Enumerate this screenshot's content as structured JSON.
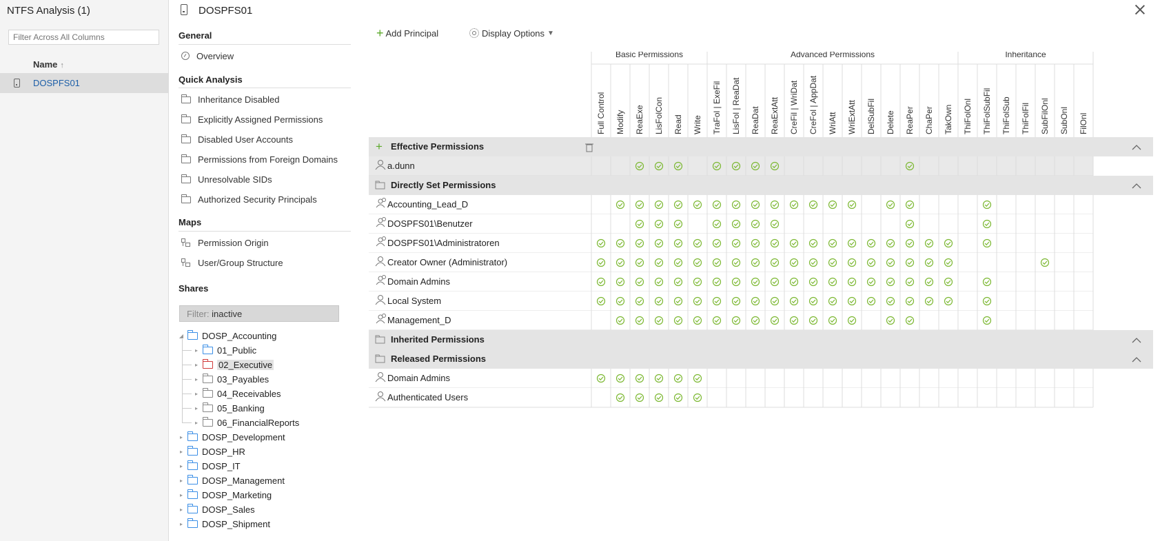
{
  "window_title": "NTFS Analysis (1)",
  "left_panel": {
    "filter_placeholder": "Filter Across All Columns",
    "column_header": "Name",
    "sort_arrow": "↑",
    "selected_item": "DOSPFS01"
  },
  "middle_panel": {
    "header_title": "DOSPFS01",
    "general": {
      "title": "General",
      "items": [
        "Overview"
      ]
    },
    "quick_analysis": {
      "title": "Quick Analysis",
      "items": [
        "Inheritance Disabled",
        "Explicitly Assigned Permissions",
        "Disabled User Accounts",
        "Permissions from Foreign Domains",
        "Unresolvable SIDs",
        "Authorized Security Principals"
      ]
    },
    "maps": {
      "title": "Maps",
      "items": [
        "Permission Origin",
        "User/Group Structure"
      ]
    },
    "shares": {
      "title": "Shares",
      "filter_key": "Filter:",
      "filter_value": "inactive",
      "tree": [
        {
          "label": "DOSP_Accounting",
          "level": 0,
          "expanded": true,
          "color": "blue"
        },
        {
          "label": "01_Public",
          "level": 1,
          "color": "blue"
        },
        {
          "label": "02_Executive",
          "level": 1,
          "color": "red",
          "selected": true
        },
        {
          "label": "03_Payables",
          "level": 1,
          "color": "grey"
        },
        {
          "label": "04_Receivables",
          "level": 1,
          "color": "grey"
        },
        {
          "label": "05_Banking",
          "level": 1,
          "color": "grey"
        },
        {
          "label": "06_FinancialReports",
          "level": 1,
          "color": "grey"
        },
        {
          "label": "DOSP_Development",
          "level": 0,
          "color": "blue"
        },
        {
          "label": "DOSP_HR",
          "level": 0,
          "color": "blue"
        },
        {
          "label": "DOSP_IT",
          "level": 0,
          "color": "blue"
        },
        {
          "label": "DOSP_Management",
          "level": 0,
          "color": "blue"
        },
        {
          "label": "DOSP_Marketing",
          "level": 0,
          "color": "blue"
        },
        {
          "label": "DOSP_Sales",
          "level": 0,
          "color": "blue"
        },
        {
          "label": "DOSP_Shipment",
          "level": 0,
          "color": "blue"
        }
      ]
    }
  },
  "toolbar": {
    "add_principal": "Add Principal",
    "display_options": "Display Options"
  },
  "matrix": {
    "groups": [
      {
        "label": "Basic Permissions",
        "span": 6
      },
      {
        "label": "Advanced Permissions",
        "span": 13
      },
      {
        "label": "Inheritance",
        "span": 7
      }
    ],
    "columns": [
      "Full Control",
      "Modify",
      "ReaExe",
      "LisFolCon",
      "Read",
      "Write",
      "TraFol | ExeFil",
      "LisFol | ReaDat",
      "ReaDat",
      "ReaExtAtt",
      "CreFil | WriDat",
      "CreFol | AppDat",
      "WriAtt",
      "WriExtAtt",
      "DelSubFil",
      "Delete",
      "ReaPer",
      "ChaPer",
      "TakOwn",
      "ThiFolOnl",
      "ThiFolSubFil",
      "ThiFolSub",
      "ThiFolFil",
      "SubFilOnl",
      "SubOnl",
      "FilOnl"
    ],
    "sections": [
      {
        "title": "Effective Permissions",
        "icon": "plus",
        "rows": [
          {
            "name": "a.dunn",
            "kind": "user",
            "checks": [
              2,
              3,
              4,
              6,
              7,
              8,
              9,
              16
            ]
          }
        ]
      },
      {
        "title": "Directly Set Permissions",
        "icon": "folder",
        "rows": [
          {
            "name": "Accounting_Lead_D",
            "kind": "group",
            "checks": [
              1,
              2,
              3,
              4,
              5,
              6,
              7,
              8,
              9,
              10,
              11,
              12,
              13,
              15,
              16,
              20
            ]
          },
          {
            "name": "DOSPFS01\\Benutzer",
            "kind": "group",
            "checks": [
              2,
              3,
              4,
              6,
              7,
              8,
              9,
              16,
              20
            ]
          },
          {
            "name": "DOSPFS01\\Administratoren",
            "kind": "group",
            "checks": [
              0,
              1,
              2,
              3,
              4,
              5,
              6,
              7,
              8,
              9,
              10,
              11,
              12,
              13,
              14,
              15,
              16,
              17,
              18,
              20
            ]
          },
          {
            "name": "Creator Owner (Administrator)",
            "kind": "user",
            "checks": [
              0,
              1,
              2,
              3,
              4,
              5,
              6,
              7,
              8,
              9,
              10,
              11,
              12,
              13,
              14,
              15,
              16,
              17,
              18,
              23
            ]
          },
          {
            "name": "Domain Admins",
            "kind": "group",
            "checks": [
              0,
              1,
              2,
              3,
              4,
              5,
              6,
              7,
              8,
              9,
              10,
              11,
              12,
              13,
              14,
              15,
              16,
              17,
              18,
              20
            ]
          },
          {
            "name": "Local System",
            "kind": "user",
            "checks": [
              0,
              1,
              2,
              3,
              4,
              5,
              6,
              7,
              8,
              9,
              10,
              11,
              12,
              13,
              14,
              15,
              16,
              17,
              18,
              20
            ]
          },
          {
            "name": "Management_D",
            "kind": "group",
            "checks": [
              1,
              2,
              3,
              4,
              5,
              6,
              7,
              8,
              9,
              10,
              11,
              12,
              13,
              15,
              16,
              20
            ]
          }
        ]
      },
      {
        "title": "Inherited Permissions",
        "icon": "folder",
        "rows": []
      },
      {
        "title": "Released Permissions",
        "icon": "folder",
        "rows": [
          {
            "name": "Domain Admins",
            "kind": "user",
            "checks": [
              0,
              1,
              2,
              3,
              4,
              5
            ]
          },
          {
            "name": "Authenticated Users",
            "kind": "user",
            "checks": [
              1,
              2,
              3,
              4,
              5
            ]
          }
        ]
      }
    ],
    "colors": {
      "check": "#7cb832",
      "section_bg": "#e4e4e4",
      "highlight_row": "#e9e9e9",
      "grid": "#dcdcdc"
    }
  }
}
